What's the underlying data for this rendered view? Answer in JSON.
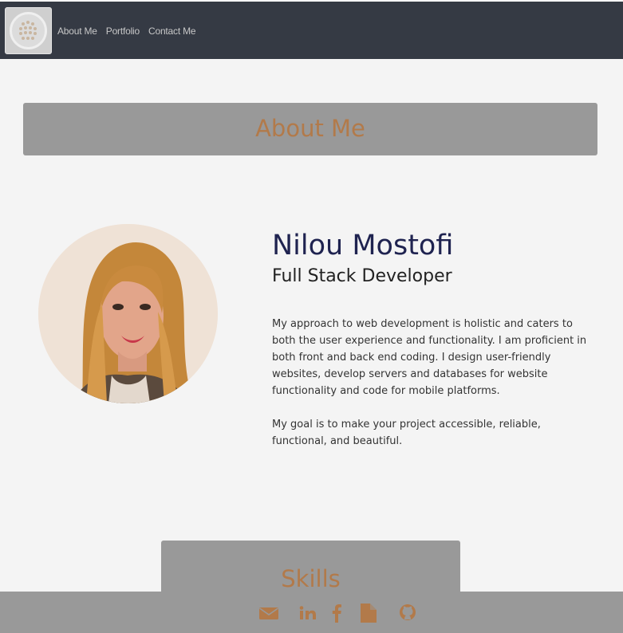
{
  "nav": {
    "items": [
      "About Me",
      "Portfolio",
      "Contact Me"
    ]
  },
  "about": {
    "heading": "About Me",
    "name": "Nilou Mostofi",
    "role": "Full Stack Developer",
    "bio": "My approach to web development is holistic and caters to both the user experience and functionality. I am proficient in both front and back end coding. I design user-friendly websites, develop servers and databases for website functionality and code for mobile platforms.",
    "goal": "My goal is to make your project accessible, reliable, functional, and beautiful."
  },
  "skills": {
    "heading": "Skills"
  },
  "footer": {
    "icons": [
      "envelope-icon",
      "linkedin-icon",
      "facebook-icon",
      "file-icon",
      "github-icon"
    ],
    "icon_color": "#b27a4a"
  },
  "colors": {
    "nav_bg": "#353a44",
    "page_bg": "#f4f4f4",
    "heading_bg": "#999999",
    "heading_text": "#b27a4a",
    "name_text": "#1f2350"
  }
}
